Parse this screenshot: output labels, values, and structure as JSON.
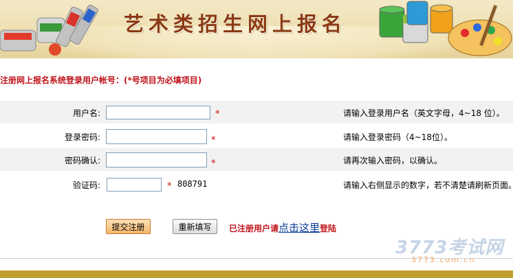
{
  "banner": {
    "title": "艺术类招生网上报名"
  },
  "form": {
    "heading": "注册网上报名系统登录用户帐号：(*号项目为必填项目)",
    "required_mark": "*",
    "fields": [
      {
        "label": "用户名:",
        "hint": "请输入登录用户名（英文字母，4~18 位）。"
      },
      {
        "label": "登录密码:",
        "hint": "请输入登录密码（4~18位）。"
      },
      {
        "label": "密码确认:",
        "hint": "请再次输入密码，以确认。"
      },
      {
        "label": "验证码:",
        "hint": "请输入右侧显示的数字，若不清楚请刷新页面。",
        "captcha": "808791"
      }
    ]
  },
  "actions": {
    "submit_label": "提交注册",
    "reset_label": "重新填写",
    "login_prefix": "已注册用户请",
    "login_link": "点击这里",
    "login_suffix": "登陆"
  },
  "watermark": {
    "brand": "3773考试网",
    "domain": "3773.com.cn"
  },
  "colors": {
    "accent_red": "#c0141b",
    "link_blue": "#0b3c9a",
    "banner_bg": "#efe1b4",
    "footer": "#c19f2d"
  }
}
